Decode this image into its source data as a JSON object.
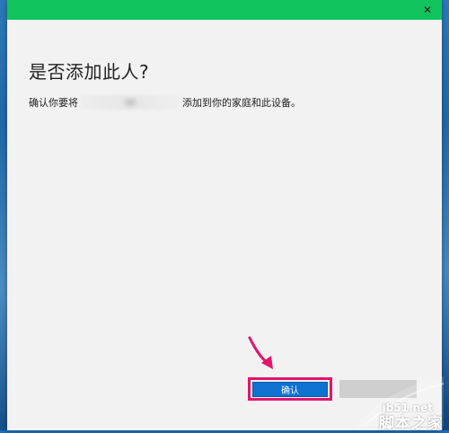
{
  "dialog": {
    "close_glyph": "✕",
    "title": "是否添加此人?",
    "message_prefix": "确认你要将",
    "message_suffix": "添加到你的家庭和此设备。",
    "confirm_label": "确认",
    "cancel_label": ""
  },
  "colors": {
    "titlebar": "#11c35d",
    "dialog_background": "#f2f2f2",
    "confirm_button": "#0f72d1",
    "highlight": "#e2156b",
    "arrow": "#e2156b"
  },
  "watermark": {
    "site": "jb51.net",
    "brand": "脚本之家"
  }
}
